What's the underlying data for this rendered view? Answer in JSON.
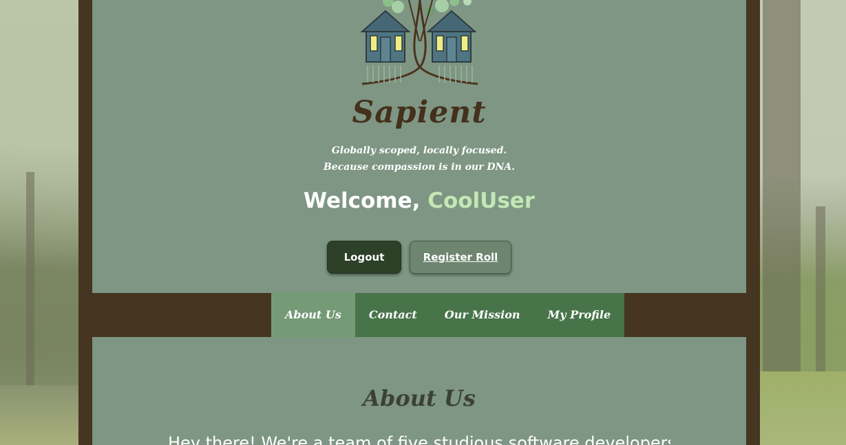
{
  "brand": {
    "name": "Sapient",
    "tagline": "Globally scoped, locally focused. Because compassion is in our DNA."
  },
  "welcome": {
    "prefix": "Welcome, ",
    "username": "CoolUser"
  },
  "actions": {
    "logout_label": "Logout",
    "register_label": "Register Roll"
  },
  "nav": {
    "items": [
      {
        "label": "About Us",
        "active": true
      },
      {
        "label": "Contact",
        "active": false
      },
      {
        "label": "Our Mission",
        "active": false
      },
      {
        "label": "My Profile",
        "active": false
      }
    ]
  },
  "about": {
    "heading": "About Us",
    "intro": "Hey there! We're a team of five studious software developers studying"
  },
  "colors": {
    "frame": "#453521",
    "panel": "#7e9683",
    "nav": "#48744a",
    "nav_active": "#749b76",
    "username_accent": "#c3e8b5",
    "logout_bg": "#2c4128"
  }
}
